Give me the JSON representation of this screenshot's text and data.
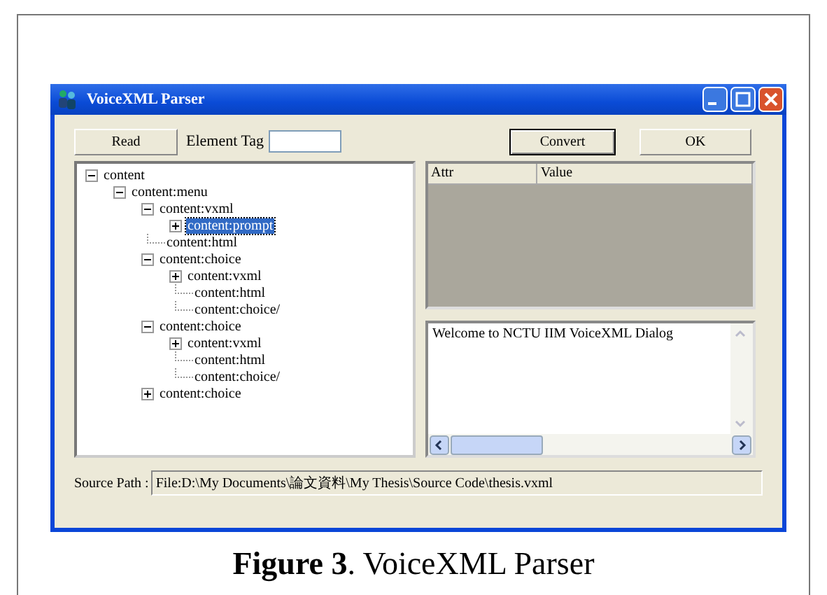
{
  "window": {
    "title": "VoiceXML Parser"
  },
  "toolbar": {
    "read_button": "Read",
    "element_tag_label": "Element Tag",
    "convert_button": "Convert",
    "ok_button": "OK"
  },
  "tree": [
    {
      "label": "content",
      "expanded": true,
      "selected": false,
      "children": [
        {
          "label": "content:menu",
          "expanded": true,
          "selected": false,
          "children": [
            {
              "label": "content:vxml",
              "expanded": true,
              "selected": false,
              "children": [
                {
                  "label": "content:prompt",
                  "expanded": false,
                  "selected": true
                }
              ]
            },
            {
              "label": "content:html",
              "selected": false
            },
            {
              "label": "content:choice",
              "expanded": true,
              "selected": false,
              "children": [
                {
                  "label": "content:vxml",
                  "expanded": false,
                  "selected": false
                },
                {
                  "label": "content:html",
                  "selected": false
                },
                {
                  "label": "content:choice/",
                  "selected": false
                }
              ]
            },
            {
              "label": "content:choice",
              "expanded": true,
              "selected": false,
              "children": [
                {
                  "label": "content:vxml",
                  "expanded": false,
                  "selected": false
                },
                {
                  "label": "content:html",
                  "selected": false
                },
                {
                  "label": "content:choice/",
                  "selected": false
                }
              ]
            },
            {
              "label": "content:choice",
              "expanded": false,
              "selected": false
            }
          ]
        }
      ]
    }
  ],
  "attributes": {
    "columns": [
      "Attr",
      "Value"
    ]
  },
  "log": {
    "text": "Welcome to NCTU IIM VoiceXML Dialog"
  },
  "source_path": {
    "label": "Source Path :",
    "value": "File:D:\\My Documents\\論文資料\\My Thesis\\Source Code\\thesis.vxml"
  },
  "caption": {
    "label": "Figure 3",
    "text": ". VoiceXML Parser"
  }
}
